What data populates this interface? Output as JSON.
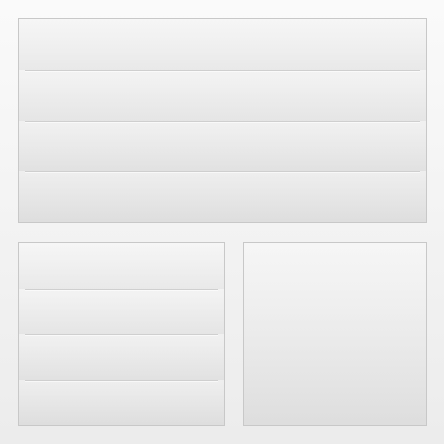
{
  "panels": {
    "top": {
      "row_count": 4
    },
    "bottom_left": {
      "row_count": 4
    },
    "bottom_right": {
      "row_count": 1
    }
  }
}
